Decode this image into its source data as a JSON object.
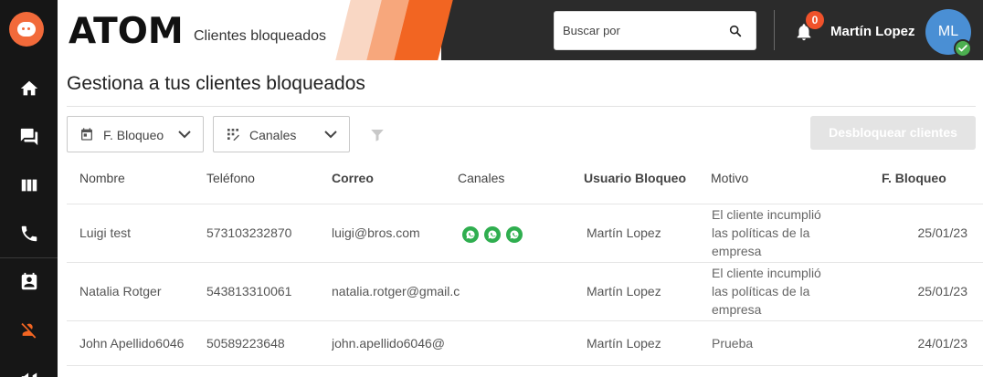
{
  "header": {
    "brand": "ATOM",
    "section_title": "Clientes bloqueados",
    "search_placeholder": "Buscar por",
    "notifications_count": "0",
    "user_name": "Martín Lopez",
    "user_initials": "ML"
  },
  "colors": {
    "accent": "#f26522",
    "sidebar_bg": "#161616",
    "header_bg": "#2b2b2b",
    "avatar_bg": "#4a8fd4",
    "whatsapp": "#2fae4f",
    "badge": "#f0522b",
    "online": "#4caf50"
  },
  "sidebar": {
    "items": [
      {
        "icon": "home-icon"
      },
      {
        "icon": "chat-icon"
      },
      {
        "icon": "board-icon"
      },
      {
        "icon": "phone-icon"
      },
      {
        "icon": "contact-card-icon"
      },
      {
        "icon": "blocked-user-icon"
      },
      {
        "icon": "megaphone-icon"
      }
    ]
  },
  "main": {
    "page_title": "Gestiona a tus clientes bloqueados",
    "filters": [
      {
        "label": "F. Bloqueo",
        "icon": "calendar-icon"
      },
      {
        "label": "Canales",
        "icon": "channels-grid-icon"
      }
    ],
    "unblock_label": "Desbloquear clientes"
  },
  "table": {
    "headers": [
      "Nombre",
      "Teléfono",
      "Correo",
      "Canales",
      "Usuario Bloqueo",
      "Motivo",
      "F. Bloqueo"
    ],
    "rows": [
      {
        "nombre": "Luigi test",
        "telefono": "573103232870",
        "correo": "luigi@bros.com",
        "canales": [
          "whatsapp-icon",
          "whatsapp-icon",
          "whatsapp-icon"
        ],
        "usuario": "Martín Lopez",
        "motivo": "El cliente incumplió las políticas de la empresa",
        "fecha": "25/01/23"
      },
      {
        "nombre": "Natalia Rotger",
        "telefono": "543813310061",
        "correo": "natalia.rotger@gmail.com",
        "canales": [],
        "usuario": "Martín Lopez",
        "motivo": "El cliente incumplió las políticas de la empresa",
        "fecha": "25/01/23"
      },
      {
        "nombre": "John Apellido6046",
        "telefono": "50589223648",
        "correo": "john.apellido6046@",
        "canales": [],
        "usuario": "Martín Lopez",
        "motivo": "Prueba",
        "fecha": "24/01/23"
      }
    ]
  }
}
